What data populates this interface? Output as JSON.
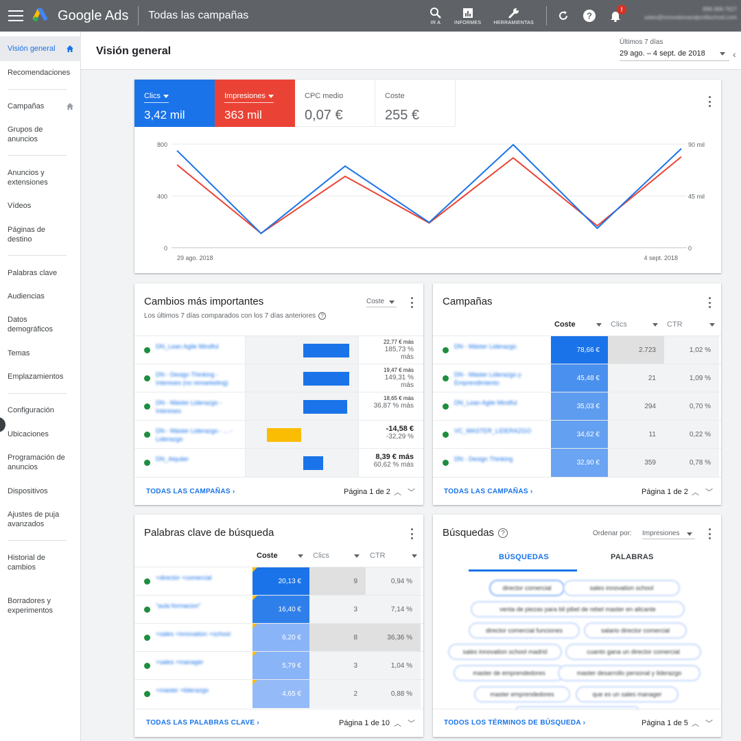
{
  "app": {
    "brand": "Google Ads",
    "breadcrumb": "Todas las campañas",
    "tools": [
      {
        "label": "IR A",
        "icon": "search-icon"
      },
      {
        "label": "INFORMES",
        "icon": "bar-chart-icon"
      },
      {
        "label": "HERRAMIENTAS",
        "icon": "wrench-icon"
      }
    ],
    "notification_badge": "!",
    "account_line1": "898-368-7627",
    "account_line2": "sales@innovationandprofitschool.com"
  },
  "sidebar": {
    "items": [
      {
        "label": "Visión general",
        "active": true
      },
      {
        "label": "Recomendaciones"
      },
      {
        "label": "Campañas"
      },
      {
        "label": "Grupos de anuncios"
      },
      {
        "label": "Anuncios y extensiones"
      },
      {
        "label": "Vídeos"
      },
      {
        "label": "Páginas de destino"
      },
      {
        "label": "Palabras clave"
      },
      {
        "label": "Audiencias"
      },
      {
        "label": "Datos demográficos"
      },
      {
        "label": "Temas"
      },
      {
        "label": "Emplazamientos"
      },
      {
        "label": "Configuración"
      },
      {
        "label": "Ubicaciones"
      },
      {
        "label": "Programación de anuncios"
      },
      {
        "label": "Dispositivos"
      },
      {
        "label": "Ajustes de puja avanzados"
      },
      {
        "label": "Historial de cambios"
      },
      {
        "label": "Borradores y experimentos"
      }
    ]
  },
  "header": {
    "title": "Visión general",
    "date_label": "Últimos 7 días",
    "date_range": "29 ago. – 4 sept. de 2018"
  },
  "overview": {
    "metrics": [
      {
        "label": "Clics",
        "value": "3,42 mil",
        "color": "#1a73e8"
      },
      {
        "label": "Impresiones",
        "value": "363 mil",
        "color": "#ea4335"
      },
      {
        "label": "CPC medio",
        "value": "0,07 €"
      },
      {
        "label": "Coste",
        "value": "255 €"
      }
    ]
  },
  "chart_data": {
    "type": "line",
    "x": [
      "29 ago. 2018",
      "30 ago. 2018",
      "31 ago. 2018",
      "1 sept. 2018",
      "2 sept. 2018",
      "3 sept. 2018",
      "4 sept. 2018"
    ],
    "xtick_labels": [
      "29 ago. 2018",
      "4 sept. 2018"
    ],
    "y_left_ticks": [
      "800",
      "400",
      "0"
    ],
    "y_right_ticks": [
      "90 mil",
      "45 mil",
      "0"
    ],
    "ylim_left": [
      0,
      800
    ],
    "ylim_right": [
      0,
      90000
    ],
    "series": [
      {
        "name": "Clics",
        "axis": "left",
        "color": "#1a73e8",
        "values": [
          750,
          110,
          630,
          195,
          795,
          150,
          765
        ]
      },
      {
        "name": "Impresiones",
        "axis": "right",
        "color": "#ea4335",
        "values": [
          72000,
          12500,
          62000,
          21500,
          78000,
          19000,
          79000
        ]
      }
    ],
    "grid": true
  },
  "changes": {
    "title": "Cambios más importantes",
    "subtitle": "Los últimos 7 días comparados con los 7 días anteriores",
    "sort_label": "Coste",
    "rows": [
      {
        "name": "DN_Lean Agile Mindful",
        "bar": 0.67,
        "negative": false,
        "line1": "22,77 € más",
        "line2": "185,73 %",
        "line3": "más"
      },
      {
        "name": "DN - Design Thinking - Intereses (no remarketing)",
        "bar": 0.67,
        "negative": false,
        "line1": "19,47 € más",
        "line2": "149,31 %",
        "line3": "más"
      },
      {
        "name": "DN - Máster Liderazgo - Intereses",
        "bar": 0.64,
        "negative": false,
        "line1": "18,65 € más",
        "line2": "36,87 % más",
        "line3": ""
      },
      {
        "name": "DN - Máster Liderazgo - ... - Liderazgo",
        "bar": 0.5,
        "negative": true,
        "line1": "-14,58 €",
        "line2": "-32,29 %",
        "line3": ""
      },
      {
        "name": "DN_Alquiler",
        "bar": 0.29,
        "negative": false,
        "line1": "8,39 € más",
        "line2": "60,62 % más",
        "line3": ""
      }
    ],
    "footer_link": "TODAS LAS CAMPAÑAS",
    "pager": "Página 1 de 2"
  },
  "campaigns": {
    "title": "Campañas",
    "columns": [
      "Coste",
      "Clics",
      "CTR"
    ],
    "rows": [
      {
        "name": "DN - Máster Liderazgo",
        "cost": "78,66 €",
        "clicks": "2.723",
        "ctr": "1,02 %"
      },
      {
        "name": "DN - Máster Liderazgo y Emprendimiento",
        "cost": "45,48 €",
        "clicks": "21",
        "ctr": "1,09 %"
      },
      {
        "name": "DN_Lean Agile Mindful",
        "cost": "35,03 €",
        "clicks": "294",
        "ctr": "0,70 %"
      },
      {
        "name": "VC_MASTER_LIDERAZGO",
        "cost": "34,62 €",
        "clicks": "11",
        "ctr": "0,22 %"
      },
      {
        "name": "DN - Design Thinking",
        "cost": "32,90 €",
        "clicks": "359",
        "ctr": "0,78 %"
      }
    ],
    "footer_link": "TODAS LAS CAMPAÑAS",
    "pager": "Página 1 de 2"
  },
  "keywords": {
    "title": "Palabras clave de búsqueda",
    "columns": [
      "Coste",
      "Clics",
      "CTR"
    ],
    "rows": [
      {
        "name": "+director +comercial",
        "cost": "20,13 €",
        "clicks": "9",
        "ctr": "0,94 %"
      },
      {
        "name": "\"aula formacion\"",
        "cost": "16,40 €",
        "clicks": "3",
        "ctr": "7,14 %"
      },
      {
        "name": "+sales +innovation +school",
        "cost": "6,20 €",
        "clicks": "8",
        "ctr": "36,36 %"
      },
      {
        "name": "+sales +manager",
        "cost": "5,79 €",
        "clicks": "3",
        "ctr": "1,04 %"
      },
      {
        "name": "+master +liderazgo",
        "cost": "4,65 €",
        "clicks": "2",
        "ctr": "0,88 %"
      }
    ],
    "footer_link": "TODAS LAS PALABRAS CLAVE",
    "pager": "Página 1 de 10"
  },
  "searches": {
    "title": "Búsquedas",
    "sort_label": "Ordenar por:",
    "sort_value": "Impresiones",
    "tabs": [
      "BÚSQUEDAS",
      "PALABRAS"
    ],
    "chips": [
      "director comercial",
      "sales innovation school",
      "venta de piezas para bil pibel de rebel master en alicante",
      "director comercial funciones",
      "salario director comercial",
      "sales innovation school madrid",
      "cuanto gana un director comercial",
      "master de emprendedores",
      "master desarrollo personal y liderazgo",
      "master emprendedores",
      "que es un sales manager"
    ],
    "footer_link": "TODOS LOS TÉRMINOS DE BÚSQUEDA",
    "pager": "Página 1 de 5"
  }
}
